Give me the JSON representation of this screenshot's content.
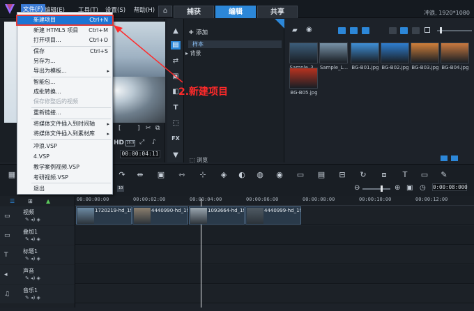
{
  "menubar": {
    "file": "文件(F)",
    "edit": "编辑(E)",
    "tools": "工具(T)",
    "settings": "设置(S)",
    "help": "帮助(H)"
  },
  "tabs": {
    "capture": "捕获",
    "edit": "编辑",
    "share": "共享"
  },
  "status": "冲浪, 1920*1080",
  "file_menu": {
    "new_project": "新建项目",
    "new_project_short": "Ctrl+N",
    "new_html5": "新建 HTML5 项目",
    "new_html5_short": "Ctrl+M",
    "open": "打开项目...",
    "open_short": "Ctrl+O",
    "save": "保存",
    "save_short": "Ctrl+S",
    "save_as": "另存为...",
    "export_template": "导出为模板...",
    "smart_package": "智能包...",
    "batch_convert": "成批转换...",
    "save_trimmed": "保存修整后的视频",
    "relink": "重新链接...",
    "insert_timeline": "将媒体文件插入到时间轴",
    "insert_library": "将媒体文件插入到素材库",
    "recent1": "冲浪.VSP",
    "recent2": "4.VSP",
    "recent3": "教学案例视频.VSP",
    "recent4": "考研视频.VSP",
    "exit": "退出"
  },
  "library": {
    "add": "添加",
    "folder_sample": "样本",
    "folder_bg": "背景",
    "browse": "浏览"
  },
  "media": [
    {
      "label": "Sample_3...",
      "color": "#3c5d7a"
    },
    {
      "label": "Sample_L...",
      "color": "#7893a8"
    },
    {
      "label": "BG-B01.jpg",
      "color": "#3f8fd6"
    },
    {
      "label": "BG-B02.jpg",
      "color": "#2f7ecf"
    },
    {
      "label": "BG-B03.jpg",
      "color": "#d07f3a"
    },
    {
      "label": "BG-B04.jpg",
      "color": "#c9793f"
    },
    {
      "label": "BG-B05.jpg",
      "color": "#b8321f"
    }
  ],
  "preview": {
    "time": "00:00:04:11",
    "hd": "HD"
  },
  "timeline": {
    "time": "0:00:08:000",
    "ticks": [
      "00:00:00:00",
      "00:00:02:00",
      "00:00:04:00",
      "00:00:06:00",
      "00:00:08:00",
      "00:00:10:00",
      "00:00:12:00"
    ],
    "tracks": [
      "视频",
      "叠加1",
      "标题1",
      "声音",
      "音乐1"
    ],
    "clips": [
      "1720219-hd_19...",
      "4440990-hd_19...",
      "1093664-hd_19...",
      "4440999-hd_19..."
    ]
  },
  "annotation": "2.新建项目",
  "colors": {
    "accent": "#2c87d8",
    "annotation": "#ff2a2a"
  }
}
